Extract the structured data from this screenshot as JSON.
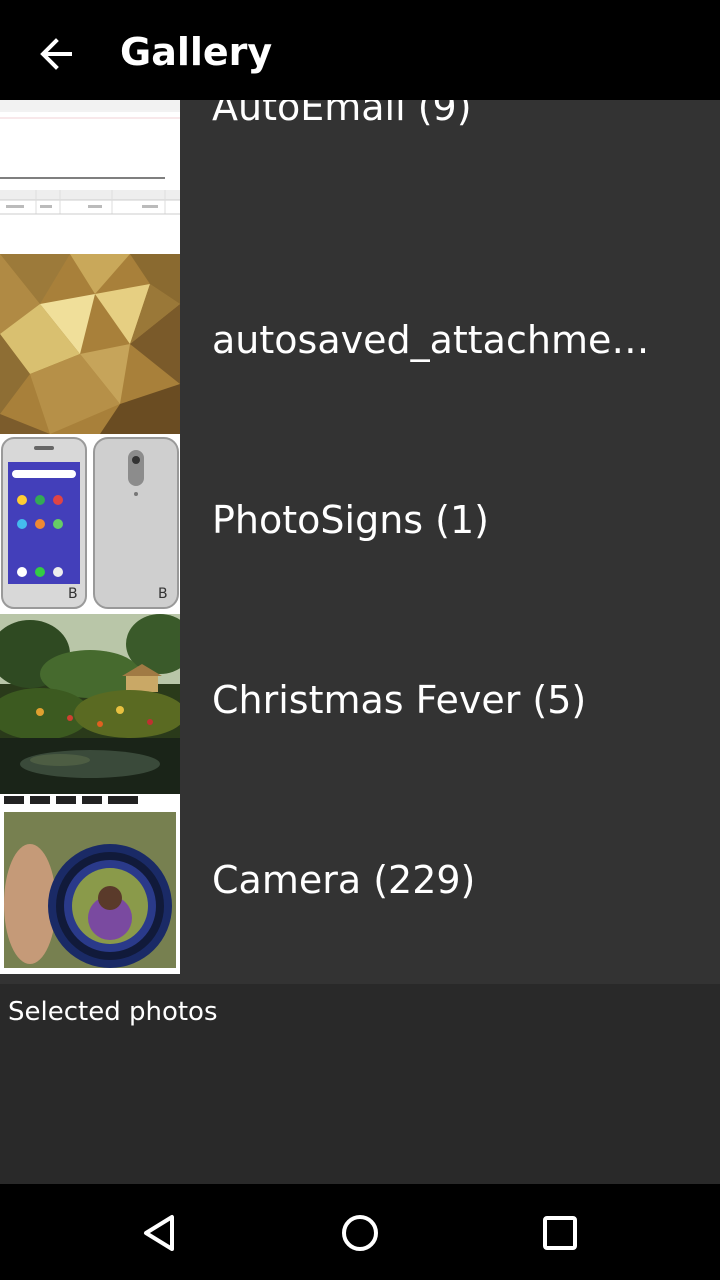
{
  "toolbar": {
    "back_icon": "arrow-left-icon",
    "title": "Gallery"
  },
  "albums": [
    {
      "label": "AutoEmail (9)",
      "thumbnail": "spreadsheet-screenshot"
    },
    {
      "label": "autosaved_attachments…",
      "thumbnail": "gold-polygon-wallpaper"
    },
    {
      "label": "PhotoSigns (1)",
      "thumbnail": "smartphone-front-back"
    },
    {
      "label": "Christmas Fever (5)",
      "thumbnail": "garden-pond"
    },
    {
      "label": "Camera (229)",
      "thumbnail": "camera-lens-portrait"
    }
  ],
  "selected": {
    "label": "Selected photos"
  },
  "navbar": {
    "back_icon": "nav-back-triangle-icon",
    "home_icon": "nav-home-circle-icon",
    "recents_icon": "nav-recents-square-icon"
  },
  "colors": {
    "toolbar_bg": "#000000",
    "list_bg": "#333333",
    "panel_bg": "#292929",
    "text": "#ffffff"
  }
}
